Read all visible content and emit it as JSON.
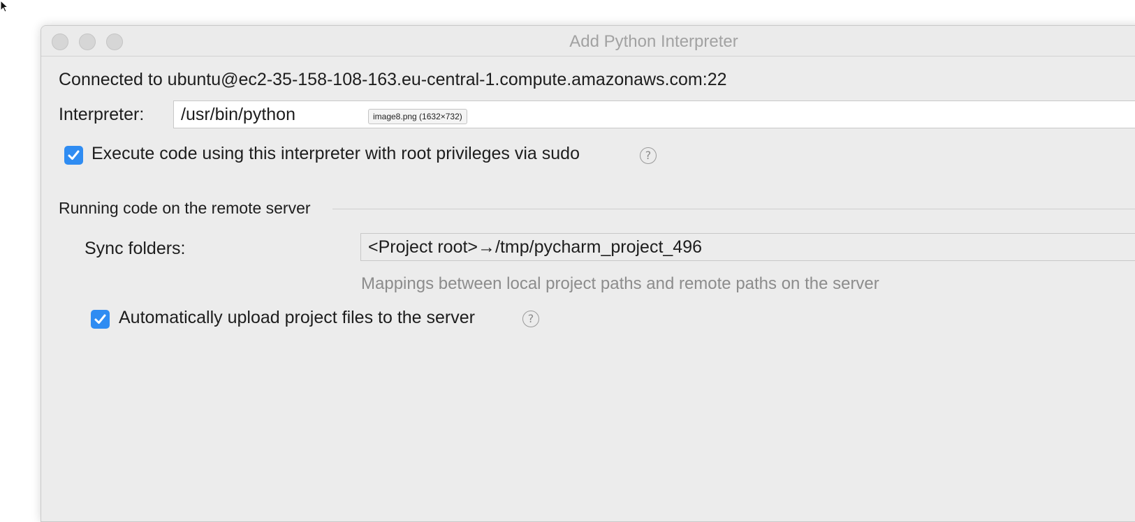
{
  "window": {
    "title": "Add Python Interpreter"
  },
  "connection": {
    "text": "Connected to ubuntu@ec2-35-158-108-163.eu-central-1.compute.amazonaws.com:22"
  },
  "interpreter": {
    "label": "Interpreter:",
    "value": "/usr/bin/python",
    "tooltip": "image8.png (1632×732)"
  },
  "sudo_option": {
    "label": "Execute code using this interpreter with root privileges via sudo",
    "checked": true,
    "help_icon": "question-mark-icon",
    "help_glyph": "?"
  },
  "remote_section": {
    "title": "Running code on the remote server",
    "sync_label": "Sync folders:",
    "sync_value": "<Project root>→/tmp/pycharm_project_496",
    "sync_hint": "Mappings between local project paths and remote paths on the server"
  },
  "upload_option": {
    "label": "Automatically upload project files to the server",
    "checked": true,
    "help_icon": "question-mark-icon",
    "help_glyph": "?"
  },
  "colors": {
    "checkbox_accent": "#2f8cf2",
    "window_bg": "#ececec",
    "hint_text": "#8c8c8c",
    "title_text": "#a2a2a2"
  }
}
